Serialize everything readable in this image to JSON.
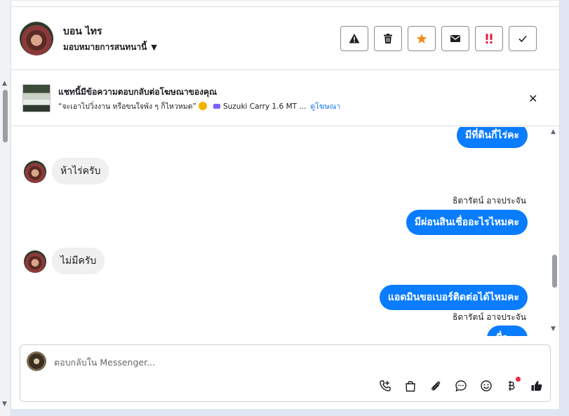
{
  "header": {
    "contact_name": "บอน ไทร",
    "assign_label": "มอบหมายการสนทนานี้",
    "toolbar_icons": [
      "warning-icon",
      "trash-icon",
      "star-icon",
      "envelope-icon",
      "double-exclamation-icon",
      "check-icon"
    ]
  },
  "ad": {
    "title": "แชทนี้มีข้อความตอบกลับต่อโฆษณาของคุณ",
    "quote": "“จะเอาไปวิ่งงาน หรือขนใจพัง ๆ ก็ไหวหมด”",
    "product": "Suzuki Carry 1.6 MT ...",
    "view_ad_link": "ดูโฆษณา"
  },
  "messages": [
    {
      "direction": "out",
      "text": "มีที่ดินกี่ไร่คะ"
    },
    {
      "direction": "in",
      "text": "ห้าไร่ครับ"
    },
    {
      "direction": "out",
      "sender": "ธิดารัตน์ อาจประจัน",
      "text": "มีผ่อนสินเชื่ออะไรไหมคะ"
    },
    {
      "direction": "in",
      "text": "ไม่มีครับ"
    },
    {
      "direction": "out",
      "text": "แอดมินขอเบอร์ติดต่อได้ไหมคะ"
    },
    {
      "direction": "out",
      "sender": "ธิดารัตน์ อาจประจัน",
      "text": "ชื่อ..."
    }
  ],
  "composer": {
    "placeholder": "ตอบกลับใน Messenger...",
    "tool_icons": [
      "call-add-icon",
      "shopping-bag-icon",
      "paperclip-icon",
      "message-bubble-icon",
      "smiley-icon",
      "baht-icon",
      "thumbs-up-icon"
    ],
    "notification_color": "#f02849"
  },
  "colors": {
    "accent": "#0a7cff",
    "star": "#f28c1c",
    "alert": "#e41e3f"
  }
}
